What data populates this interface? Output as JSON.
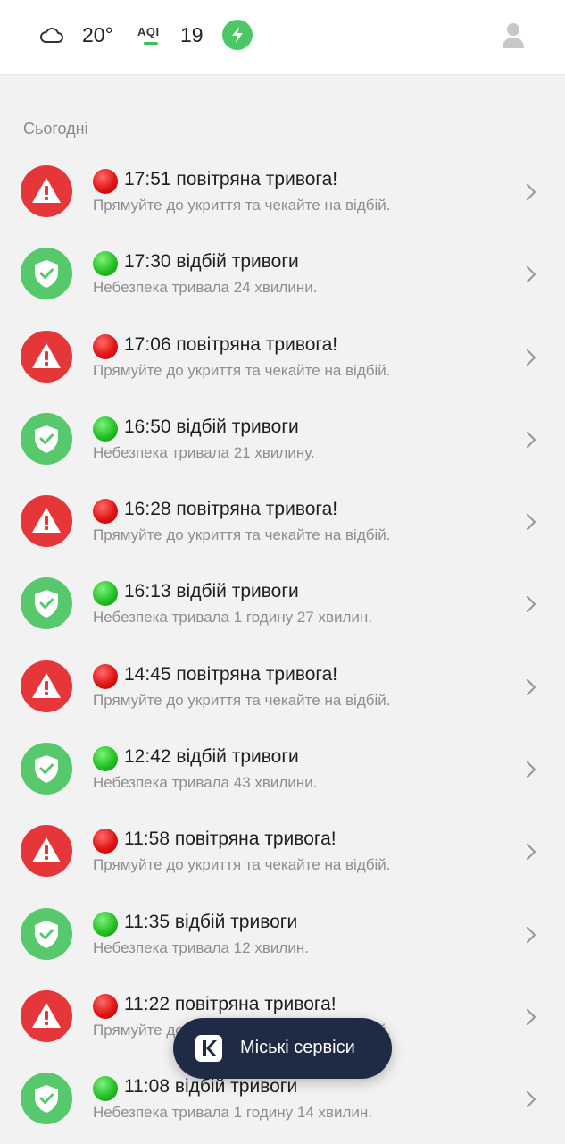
{
  "header": {
    "weather_icon": "cloud-icon",
    "temperature": "20°",
    "aqi_label": "AQI",
    "aqi_value": "19",
    "power_icon": "lightning-bolt-icon",
    "profile_icon": "user-avatar-icon"
  },
  "section_title": "Сьогодні",
  "colors": {
    "alarm": "#e5363a",
    "clear": "#57c96c",
    "fab_bg": "#1f2a44"
  },
  "events": [
    {
      "type": "alarm",
      "title": "17:51 повітряна тривога!",
      "subtitle": "Прямуйте до укриття та чекайте на відбій."
    },
    {
      "type": "clear",
      "title": "17:30 відбій тривоги",
      "subtitle": "Небезпека тривала 24 хвилини."
    },
    {
      "type": "alarm",
      "title": "17:06 повітряна тривога!",
      "subtitle": "Прямуйте до укриття та чекайте на відбій."
    },
    {
      "type": "clear",
      "title": "16:50 відбій тривоги",
      "subtitle": "Небезпека тривала 21 хвилину."
    },
    {
      "type": "alarm",
      "title": "16:28 повітряна тривога!",
      "subtitle": "Прямуйте до укриття та чекайте на відбій."
    },
    {
      "type": "clear",
      "title": "16:13 відбій тривоги",
      "subtitle": "Небезпека тривала 1 годину 27 хвилин."
    },
    {
      "type": "alarm",
      "title": "14:45 повітряна тривога!",
      "subtitle": "Прямуйте до укриття та чекайте на відбій."
    },
    {
      "type": "clear",
      "title": "12:42 відбій тривоги",
      "subtitle": "Небезпека тривала 43 хвилини."
    },
    {
      "type": "alarm",
      "title": "11:58 повітряна тривога!",
      "subtitle": "Прямуйте до укриття та чекайте на відбій."
    },
    {
      "type": "clear",
      "title": "11:35 відбій тривоги",
      "subtitle": "Небезпека тривала 12 хвилин."
    },
    {
      "type": "alarm",
      "title": "11:22 повітряна тривога!",
      "subtitle": "Прямуйте до укриття та чекайте на відбій."
    },
    {
      "type": "clear",
      "title": "11:08 відбій тривоги",
      "subtitle": "Небезпека тривала 1 годину 14 хвилин."
    }
  ],
  "fab": {
    "icon": "kyiv-logo-icon",
    "label": "Міські сервіси"
  }
}
